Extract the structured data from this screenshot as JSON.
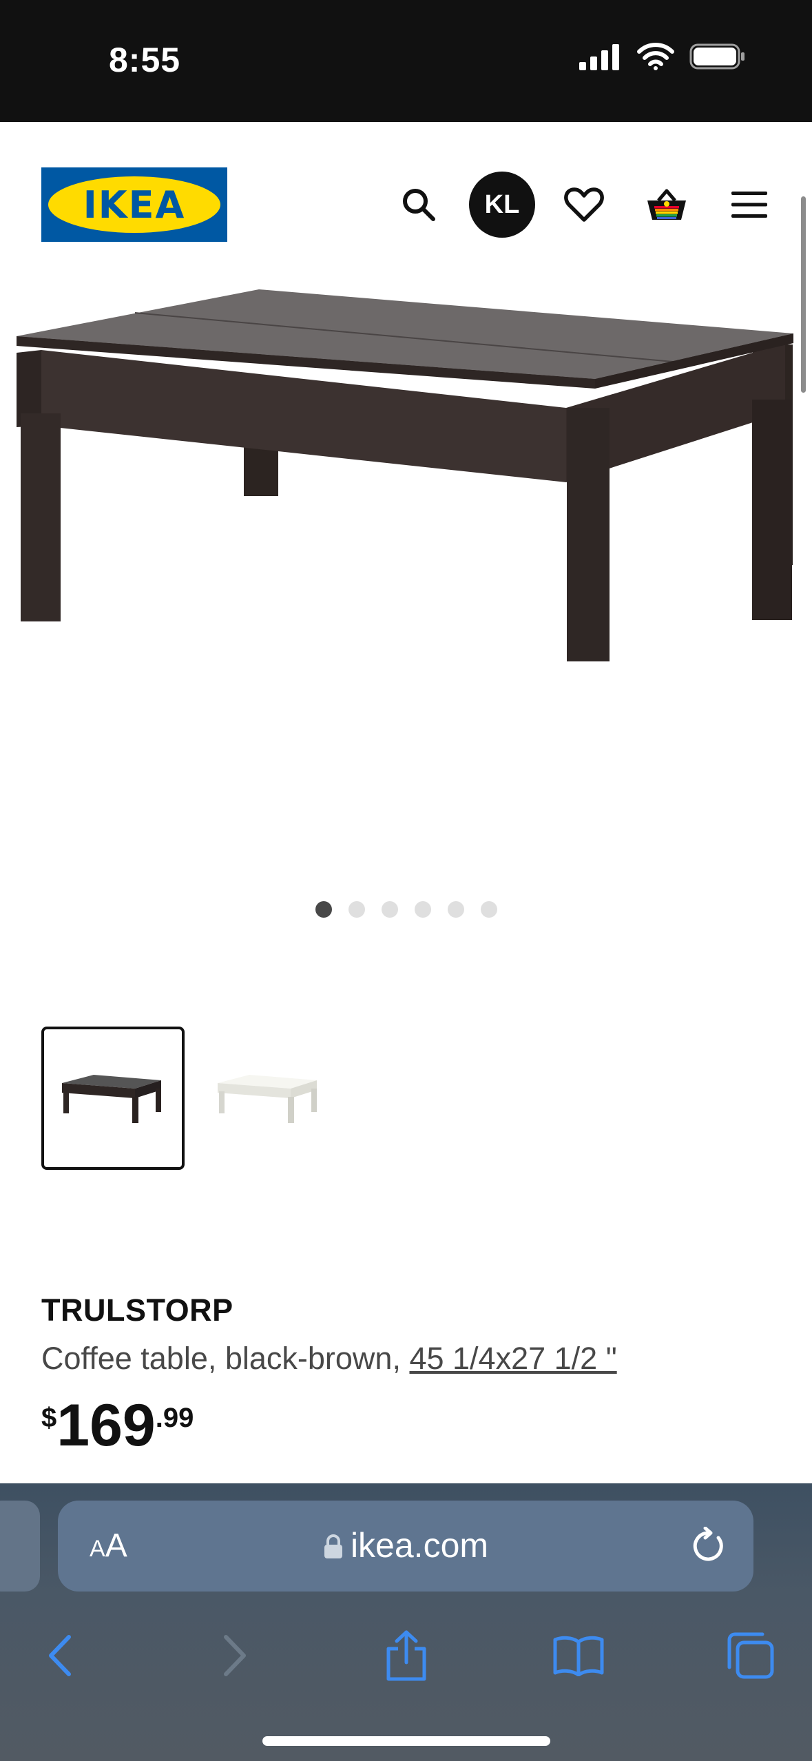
{
  "status_bar": {
    "time": "8:55"
  },
  "header": {
    "logo_text": "IKEA",
    "avatar_initials": "KL",
    "icons": [
      "search-icon",
      "heart-icon",
      "basket-icon",
      "menu-icon"
    ]
  },
  "gallery": {
    "image_count": 6,
    "active_index": 0,
    "variants": [
      {
        "name": "black-brown",
        "selected": true
      },
      {
        "name": "white",
        "selected": false
      }
    ]
  },
  "product": {
    "name": "TRULSTORP",
    "description": "Coffee table, black-brown, ",
    "dimensions": "45 1/4x27 1/2 \"",
    "price_currency": "$",
    "price_integer": "169",
    "price_decimal": ".99"
  },
  "browser": {
    "text_size_small": "A",
    "text_size_large": "A",
    "url": "ikea.com",
    "toolbar": [
      "back-icon",
      "forward-icon",
      "share-icon",
      "bookmarks-icon",
      "tabs-icon"
    ]
  },
  "colors": {
    "ikea_blue": "#0058a3",
    "ikea_yellow": "#ffdb00",
    "safari_blue": "#3d8bf0"
  }
}
